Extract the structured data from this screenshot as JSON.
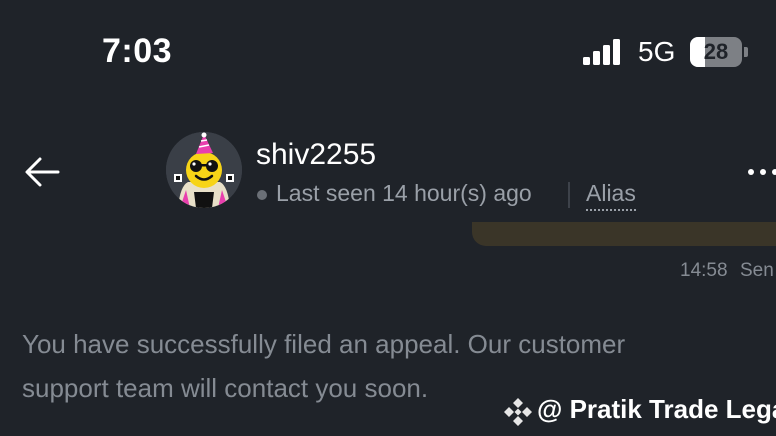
{
  "status_bar": {
    "time": "7:03",
    "network": "5G",
    "battery_level": "28",
    "battery_fraction": 0.28
  },
  "header": {
    "username": "shiv2255",
    "last_seen": "Last seen 14 hour(s) ago",
    "alias_label": "Alias",
    "back_icon": "arrow-left-icon",
    "more_icon": "more-horizontal-icon",
    "avatar": "avatar-party-hat-sunglasses"
  },
  "message": {
    "time": "14:58",
    "status": "Sen"
  },
  "notice": {
    "line1": "You have successfully filed an appeal. Our customer",
    "line2": "support team will contact you soon."
  },
  "watermark": {
    "text": "@ Pratik Trade Legal",
    "icon": "binance-diamond-icon"
  },
  "colors": {
    "background": "#1f2329",
    "muted_text": "#858b93",
    "secondary_text": "#9aa0a8",
    "bubble": "#3a3528",
    "avatar_yellow": "#f7d417",
    "party_hat_pink": "#e83fae"
  }
}
